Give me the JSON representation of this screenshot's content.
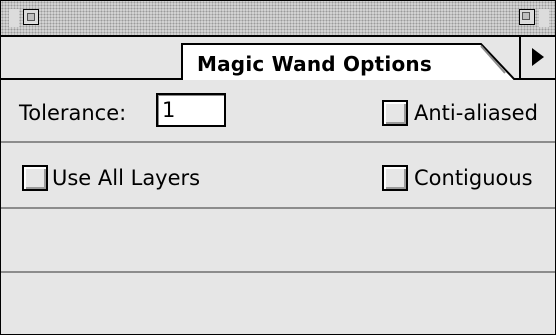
{
  "palette": {
    "tab_label": "Magic Wand Options"
  },
  "options": {
    "tolerance_label": "Tolerance:",
    "tolerance_value": "1",
    "anti_aliased_label": "Anti-aliased",
    "anti_aliased_checked": false,
    "use_all_layers_label": "Use All Layers",
    "use_all_layers_checked": false,
    "contiguous_label": "Contiguous",
    "contiguous_checked": false
  },
  "icons": {
    "close": "close-box-icon",
    "zoom": "zoom-box-icon",
    "menu": "triangle-right-icon"
  }
}
